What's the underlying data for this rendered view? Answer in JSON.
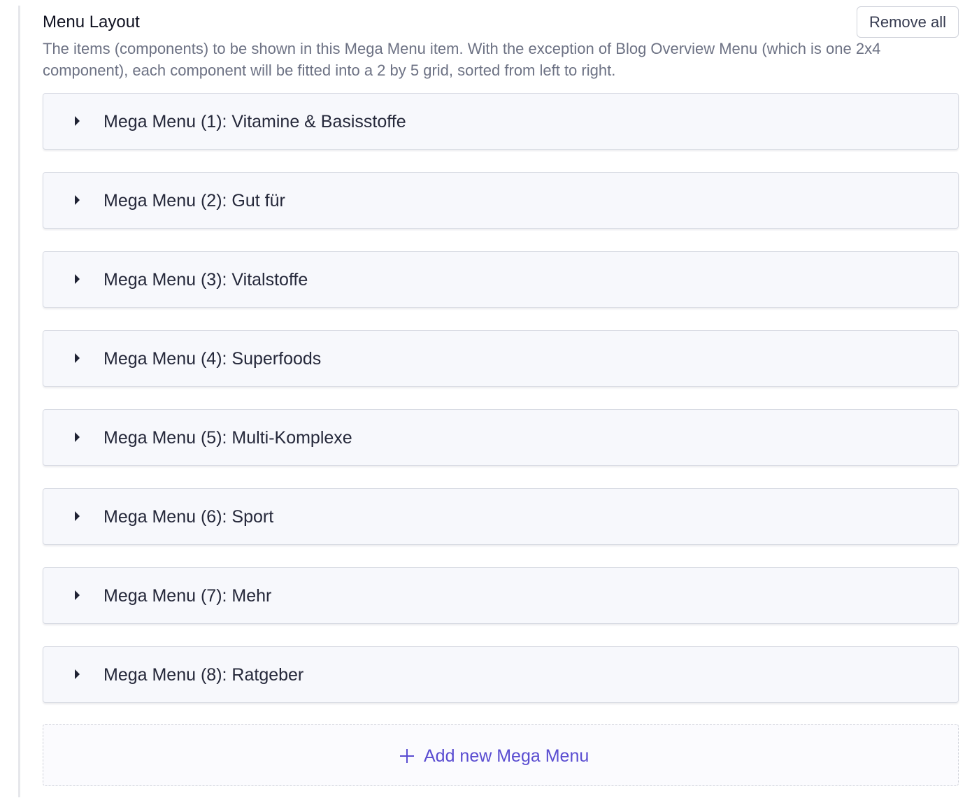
{
  "section": {
    "title": "Menu Layout",
    "remove_all_label": "Remove all",
    "description": "The items (components) to be shown in this Mega Menu item. With the exception of Blog Overview Menu (which is one 2x4 component), each component will be fitted into a 2 by 5 grid, sorted from left to right."
  },
  "mega_menus": [
    {
      "label": "Mega Menu (1): Vitamine & Basisstoffe",
      "expanded": false
    },
    {
      "label": "Mega Menu (2): Gut für",
      "expanded": false
    },
    {
      "label": "Mega Menu (3): Vitalstoffe",
      "expanded": false
    },
    {
      "label": "Mega Menu (4): Superfoods",
      "expanded": false
    },
    {
      "label": "Mega Menu (5): Multi-Komplexe",
      "expanded": false
    },
    {
      "label": "Mega Menu (6): Sport",
      "expanded": false
    },
    {
      "label": "Mega Menu (7): Mehr",
      "expanded": false
    },
    {
      "label": "Mega Menu (8): Ratgeber",
      "expanded": false
    }
  ],
  "add_new": {
    "label": "Add new Mega Menu",
    "icon": "plus-icon",
    "accent_color": "#5a4dd1"
  },
  "icons": {
    "item_toggle": "caret-right-icon"
  }
}
